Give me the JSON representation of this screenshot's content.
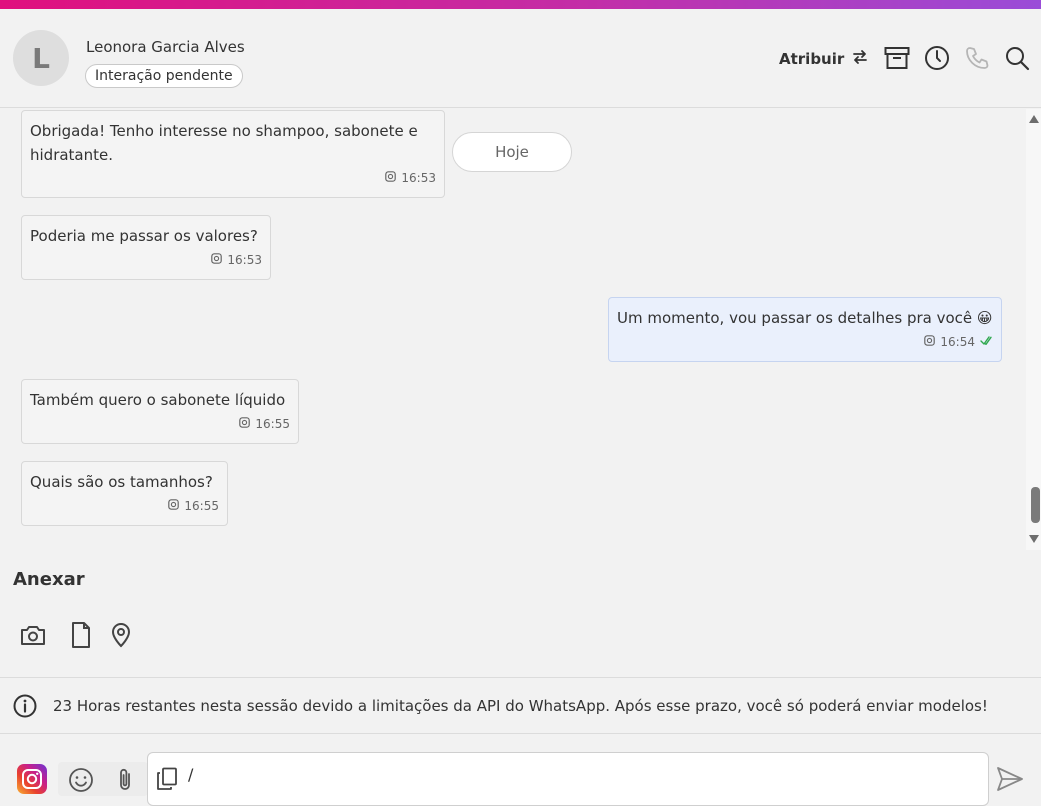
{
  "header": {
    "avatar_initial": "L",
    "contact_name": "Leonora Garcia Alves",
    "status": "Interação pendente",
    "assign_label": "Atribuir",
    "icons": [
      "swap-arrows-icon",
      "archive-icon",
      "clock-icon",
      "phone-icon",
      "search-icon"
    ]
  },
  "chat": {
    "date_separator": "Hoje",
    "messages": [
      {
        "direction": "in",
        "text_line1": "Obrigada! Tenho interesse no shampoo, sabonete e",
        "text_line2": "hidratante.",
        "time": "16:53",
        "channel_icon": "instagram-icon"
      },
      {
        "direction": "in",
        "text": "Poderia me passar os valores?",
        "time": "16:53",
        "channel_icon": "instagram-icon"
      },
      {
        "direction": "out",
        "text": "Um momento, vou passar os detalhes pra você 😀",
        "time": "16:54",
        "channel_icon": "instagram-icon",
        "status_icon": "double-check-icon"
      },
      {
        "direction": "in",
        "text": "Também quero o sabonete líquido",
        "time": "16:55",
        "channel_icon": "instagram-icon"
      },
      {
        "direction": "in",
        "text": "Quais são os tamanhos?",
        "time": "16:55",
        "channel_icon": "instagram-icon"
      }
    ]
  },
  "attach": {
    "title": "Anexar",
    "icons": [
      "camera-icon",
      "document-icon",
      "location-pin-icon"
    ]
  },
  "notice": {
    "icon": "info-icon",
    "text": "23 Horas restantes nesta sessão devido a limitações da API do WhatsApp. Após esse prazo, você só poderá enviar modelos!"
  },
  "composer": {
    "channel_icon": "instagram-icon",
    "input_value": "/",
    "icons": [
      "emoji-icon",
      "paperclip-icon",
      "copy-template-icon",
      "send-icon"
    ]
  },
  "colors": {
    "accent_gradient_start": "#e0107e",
    "accent_gradient_end": "#9a4cd8",
    "outgoing_bubble": "#eaf0fc",
    "incoming_bubble": "#f4f4f4",
    "read_check": "#2fa84f"
  }
}
